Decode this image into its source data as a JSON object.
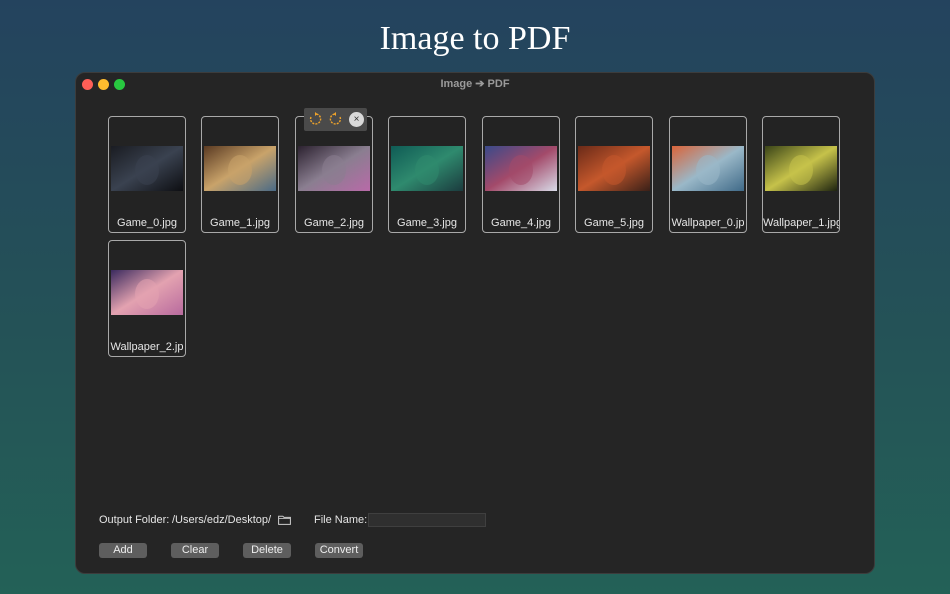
{
  "promo": {
    "title": "Image to PDF"
  },
  "window": {
    "title": "Image ➔ PDF"
  },
  "images": [
    {
      "name": "Game_0.jpg",
      "colors": [
        "#1a1c22",
        "#3a4250",
        "#0d0e12"
      ]
    },
    {
      "name": "Game_1.jpg",
      "colors": [
        "#5a3a22",
        "#c9a36a",
        "#4a6a86"
      ]
    },
    {
      "name": "Game_2.jpg",
      "colors": [
        "#2c2230",
        "#8a7e90",
        "#b86aa8"
      ]
    },
    {
      "name": "Game_3.jpg",
      "colors": [
        "#0f5b55",
        "#2f8a6e",
        "#1b3b3e"
      ]
    },
    {
      "name": "Game_4.jpg",
      "colors": [
        "#3a4a8a",
        "#a34a6a",
        "#d8dbe8"
      ]
    },
    {
      "name": "Game_5.jpg",
      "colors": [
        "#6a2a18",
        "#c5582c",
        "#3a2018"
      ]
    },
    {
      "name": "Wallpaper_0.jp",
      "colors": [
        "#d9643a",
        "#9ab8c8",
        "#406a88"
      ]
    },
    {
      "name": "Wallpaper_1.jpg",
      "colors": [
        "#3a4418",
        "#c6c24a",
        "#1e2410"
      ]
    },
    {
      "name": "Wallpaper_2.jp",
      "colors": [
        "#3a2a5e",
        "#e3a2b0",
        "#b86a9e"
      ]
    }
  ],
  "bottom": {
    "output_folder_label": "Output Folder:",
    "output_folder_path": "/Users/edz/Desktop/",
    "file_name_label": "File Name:",
    "file_name_value": "",
    "buttons": {
      "add": "Add",
      "clear": "Clear",
      "delete": "Delete",
      "convert": "Convert"
    }
  },
  "icons": {
    "close": "close-window-button",
    "minimize": "minimize-window-button",
    "maximize": "maximize-window-button",
    "rotate_left": "rotate-left-icon",
    "rotate_right": "rotate-right-icon",
    "remove": "remove-image-icon",
    "folder": "folder-icon"
  },
  "colors": {
    "accent_orange": "#f0a42b",
    "traffic_red": "#fe5f57",
    "traffic_yellow": "#febc2e",
    "traffic_green": "#28c840"
  }
}
